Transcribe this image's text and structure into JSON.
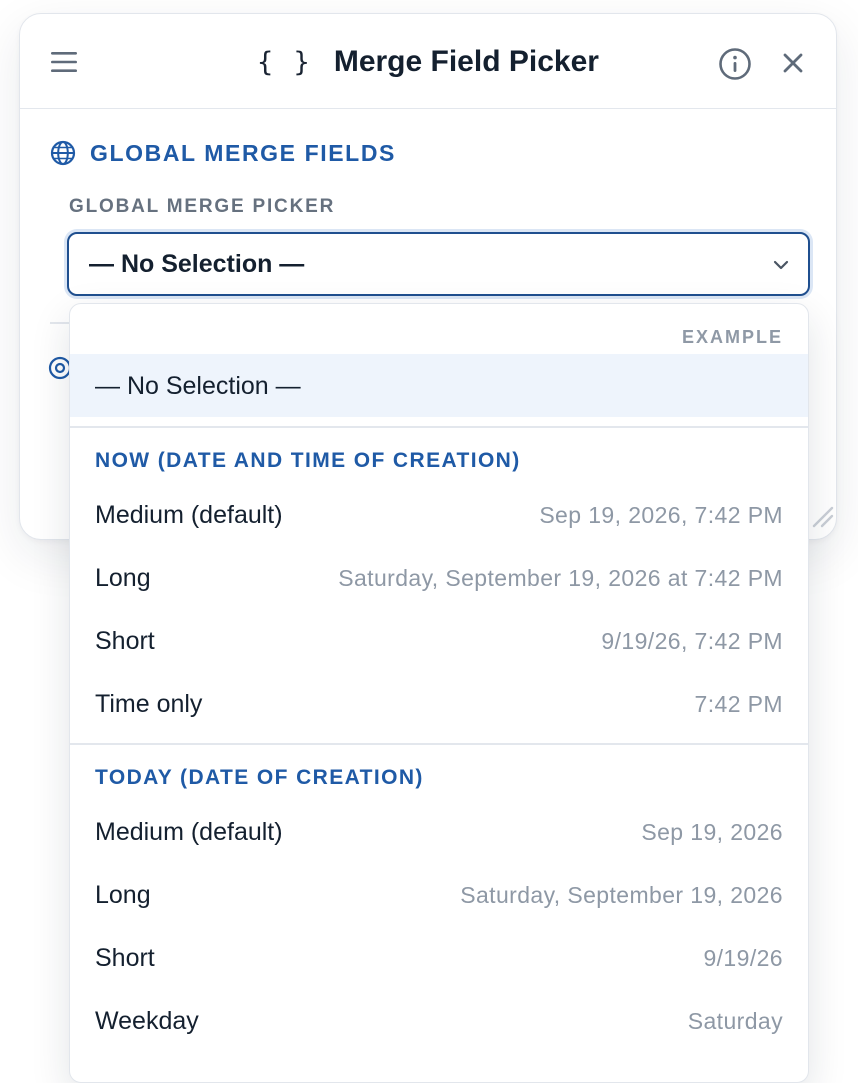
{
  "header": {
    "title": "Merge Field Picker",
    "braces_glyph": "{ }",
    "icons": [
      "menu-icon",
      "braces-icon",
      "info-icon",
      "close-icon"
    ]
  },
  "section": {
    "heading": "GLOBAL MERGE FIELDS",
    "icon": "globe-icon"
  },
  "picker": {
    "label": "GLOBAL MERGE PICKER",
    "selected_value": "— No Selection —"
  },
  "dropdown": {
    "column_header": "EXAMPLE",
    "no_selection": "— No Selection —",
    "groups": [
      {
        "label": "NOW (DATE AND TIME OF CREATION)",
        "options": [
          {
            "label": "Medium (default)",
            "example": "Sep 19, 2026, 7:42 PM"
          },
          {
            "label": "Long",
            "example": "Saturday, September 19, 2026 at 7:42 PM"
          },
          {
            "label": "Short",
            "example": "9/19/26, 7:42 PM"
          },
          {
            "label": "Time only",
            "example": "7:42 PM"
          }
        ]
      },
      {
        "label": "TODAY (DATE OF CREATION)",
        "options": [
          {
            "label": "Medium (default)",
            "example": "Sep 19, 2026"
          },
          {
            "label": "Long",
            "example": "Saturday, September 19, 2026"
          },
          {
            "label": "Short",
            "example": "9/19/26"
          },
          {
            "label": "Weekday",
            "example": "Saturday"
          }
        ]
      }
    ]
  },
  "colors": {
    "accent": "#1f5aa6",
    "focus_border": "#1f4f8f",
    "selected_row_bg": "#eef4fc",
    "muted_text": "#8e98a5"
  }
}
